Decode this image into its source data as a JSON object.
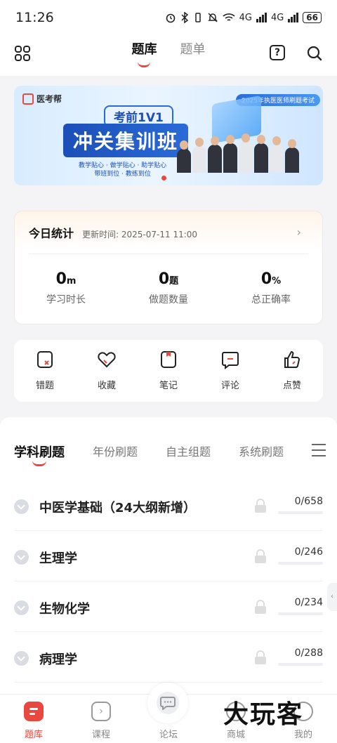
{
  "status_bar": {
    "time": "11:26",
    "net1": "4G",
    "net2": "4G",
    "battery": "66"
  },
  "header": {
    "tabs": [
      {
        "label": "题库",
        "active": true
      },
      {
        "label": "题单",
        "active": false
      }
    ],
    "help": "?"
  },
  "banner": {
    "brand": "医考帮",
    "promo": "2025年执医医师刷题考试",
    "tag": "考前1V1",
    "title": "冲关集训班",
    "sub1": "教学贴心 · 做学贴心 · 助学贴心",
    "sub2": "带班到位 · 教练到位"
  },
  "stats": {
    "title": "今日统计",
    "updated_label": "更新时间:",
    "updated_value": "2025-07-11 11:00",
    "items": [
      {
        "value": "0",
        "unit": "m",
        "label": "学习时长"
      },
      {
        "value": "0",
        "unit": "题",
        "label": "做题数量"
      },
      {
        "value": "0",
        "unit": "%",
        "label": "总正确率"
      }
    ]
  },
  "shortcuts": [
    {
      "label": "错题",
      "icon": "wrong-question-icon"
    },
    {
      "label": "收藏",
      "icon": "heart-icon"
    },
    {
      "label": "笔记",
      "icon": "note-icon"
    },
    {
      "label": "评论",
      "icon": "comment-icon"
    },
    {
      "label": "点赞",
      "icon": "thumbs-up-icon"
    }
  ],
  "subject_tabs": [
    {
      "label": "学科刷题",
      "active": true
    },
    {
      "label": "年份刷题",
      "active": false
    },
    {
      "label": "自主组题",
      "active": false
    },
    {
      "label": "系统刷题",
      "active": false
    }
  ],
  "subjects": [
    {
      "name": "中医学基础（24大纲新增）",
      "count": "0/658"
    },
    {
      "name": "生理学",
      "count": "0/246"
    },
    {
      "name": "生物化学",
      "count": "0/234"
    },
    {
      "name": "病理学",
      "count": "0/288"
    }
  ],
  "bottom_nav": [
    {
      "label": "题库",
      "active": true
    },
    {
      "label": "课程",
      "active": false
    },
    {
      "label": "论坛",
      "active": false
    },
    {
      "label": "商城",
      "active": false
    },
    {
      "label": "我的",
      "active": false
    }
  ],
  "watermark": "大玩客",
  "colors": {
    "accent": "#e8483d",
    "banner_blue": "#2a6bd8"
  }
}
